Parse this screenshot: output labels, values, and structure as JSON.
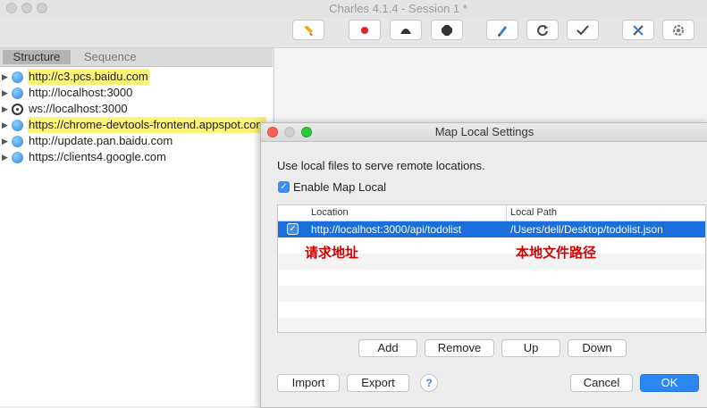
{
  "window": {
    "title": "Charles 4.1.4 - Session 1 *"
  },
  "toolbar": {
    "icons": [
      "broom-icon",
      "record-icon",
      "throttle-icon",
      "stop-icon",
      "pen-icon",
      "refresh-icon",
      "check-icon",
      "tools-icon",
      "settings-icon"
    ]
  },
  "left_panel": {
    "tabs": [
      "Structure",
      "Sequence"
    ],
    "tree": [
      {
        "label": "http://c3.pcs.baidu.com",
        "highlighted": true,
        "icon": "globe-icon"
      },
      {
        "label": "http://localhost:3000",
        "highlighted": false,
        "icon": "globe-icon"
      },
      {
        "label": "ws://localhost:3000",
        "highlighted": false,
        "icon": "websocket-icon"
      },
      {
        "label": "https://chrome-devtools-frontend.appspot.com",
        "highlighted": true,
        "icon": "globe-icon"
      },
      {
        "label": "http://update.pan.baidu.com",
        "highlighted": false,
        "icon": "globe-icon"
      },
      {
        "label": "https://clients4.google.com",
        "highlighted": false,
        "icon": "globe-icon"
      }
    ]
  },
  "dialog": {
    "title": "Map Local Settings",
    "description": "Use local files to serve remote locations.",
    "enable_label": "Enable Map Local",
    "columns": [
      "Location",
      "Local Path"
    ],
    "rows": [
      {
        "checked": true,
        "location": "http://localhost:3000/api/todolist",
        "local_path": "/Users/dell/Desktop/todolist.json"
      }
    ],
    "annotations": {
      "location_note": "请求地址",
      "path_note": "本地文件路径"
    },
    "buttons": {
      "add": "Add",
      "remove": "Remove",
      "up": "Up",
      "down": "Down",
      "import": "Import",
      "export": "Export",
      "help": "?",
      "cancel": "Cancel",
      "ok": "OK"
    }
  },
  "colors": {
    "selection": "#1a6fdc",
    "highlight": "#fbf27a",
    "annotation": "#d30000",
    "primary_button": "#2b87f5"
  }
}
